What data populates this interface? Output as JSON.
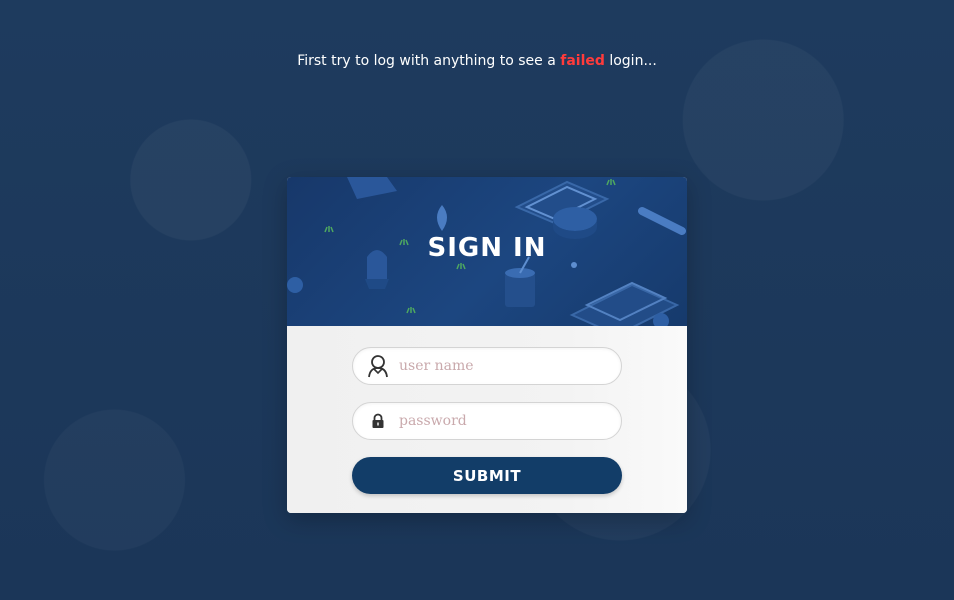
{
  "hint": {
    "before": "First try to log with anything to see a ",
    "highlight": "failed",
    "after": " login..."
  },
  "card": {
    "title": "SIGN IN",
    "username": {
      "placeholder": "user name",
      "value": "",
      "icon": "user-icon"
    },
    "password": {
      "placeholder": "password",
      "value": "",
      "icon": "lock-icon"
    },
    "submit_label": "SUBMIT"
  },
  "colors": {
    "background": "#1d3a5c",
    "header": "#1c4680",
    "button": "#123d68",
    "failed": "#ff3b3b",
    "placeholder": "#c9a9ac"
  }
}
